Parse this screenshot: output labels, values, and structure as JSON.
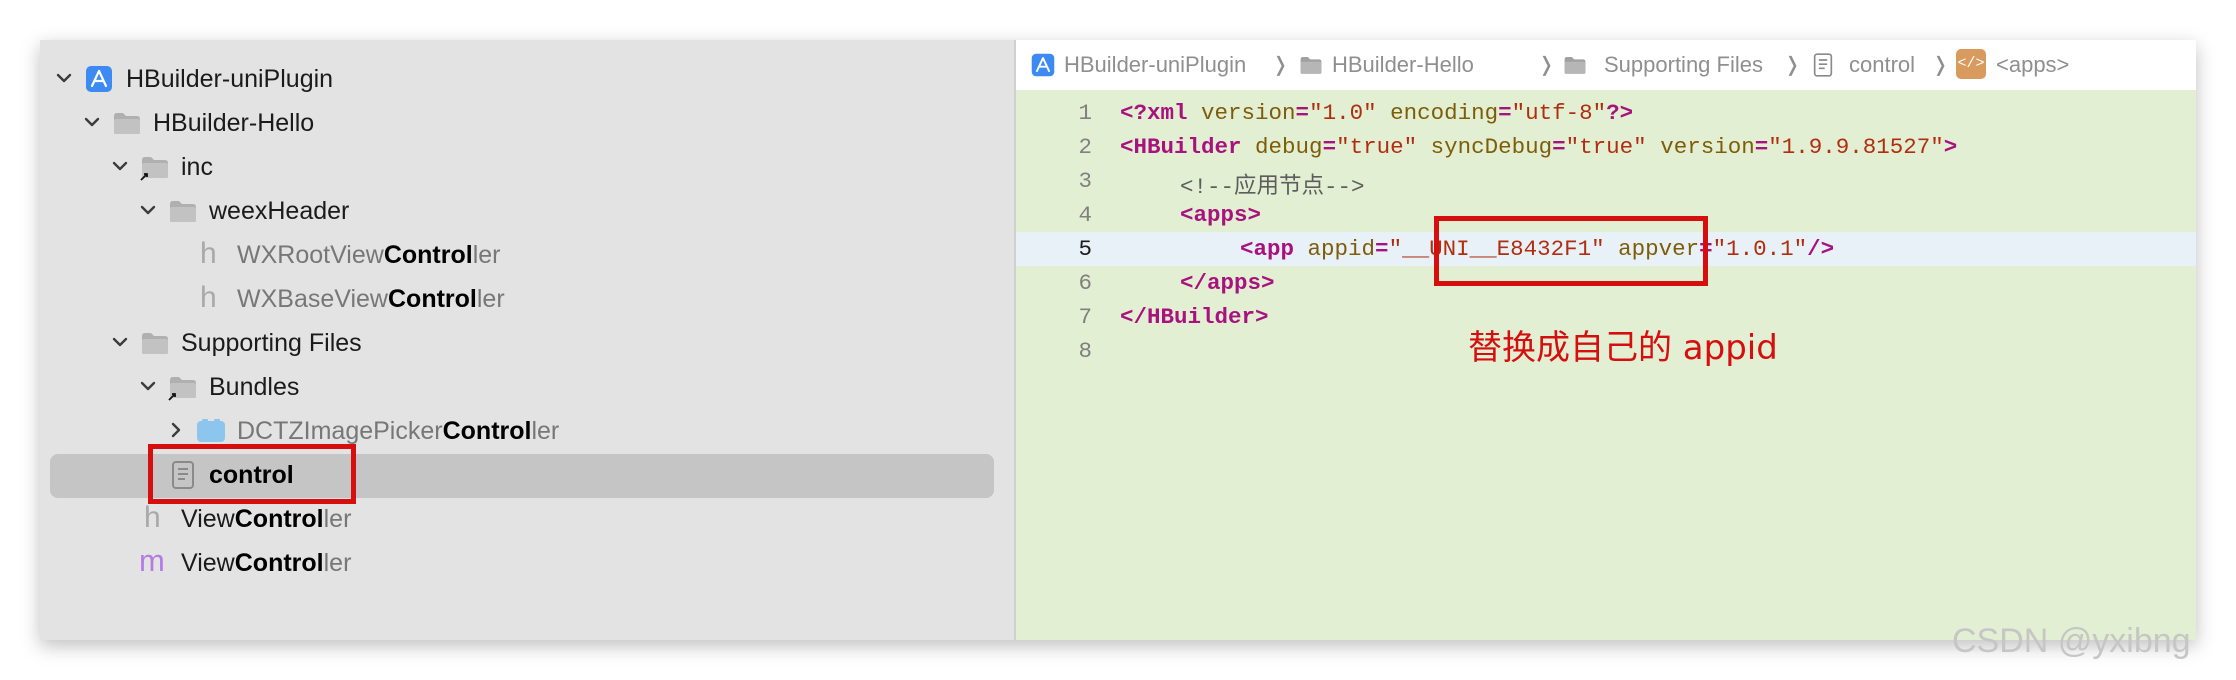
{
  "navigator": {
    "items": [
      {
        "name": "HBuilder-uniPlugin",
        "icon": "xcode-project-icon",
        "expanded": true
      },
      {
        "name": "HBuilder-Hello",
        "icon": "folder-icon",
        "expanded": true
      },
      {
        "name": "inc",
        "icon": "folder-alias-icon",
        "expanded": true
      },
      {
        "name": "weexHeader",
        "icon": "folder-icon",
        "expanded": true
      },
      {
        "name_prefix": "WXRootView",
        "name_match": "Control",
        "name_suffix": "ler",
        "icon": "header-file-icon"
      },
      {
        "name_prefix": "WXBaseView",
        "name_match": "Control",
        "name_suffix": "ler",
        "icon": "header-file-icon"
      },
      {
        "name": "Supporting Files",
        "icon": "folder-icon",
        "expanded": true
      },
      {
        "name": "Bundles",
        "icon": "folder-alias-icon",
        "expanded": true
      },
      {
        "name_prefix": "DCTZImagePicker",
        "name_match": "Control",
        "name_suffix": "ler",
        "icon": "bundle-icon",
        "expanded": false
      },
      {
        "name": "control",
        "icon": "xml-file-icon",
        "selected": true
      },
      {
        "name_prefix": "View",
        "name_match": "Control",
        "name_suffix": "ler",
        "icon": "header-file-icon"
      },
      {
        "name_prefix": "View",
        "name_match": "Control",
        "name_suffix": "ler",
        "icon": "objc-implementation-icon"
      }
    ]
  },
  "jumpbar": {
    "crumbs": [
      "HBuilder-uniPlugin",
      "HBuilder-Hello",
      "Supporting Files",
      "control",
      "<apps>"
    ]
  },
  "editor": {
    "lines": [
      {
        "num": "1"
      },
      {
        "num": "2"
      },
      {
        "num": "3"
      },
      {
        "num": "4"
      },
      {
        "num": "5"
      },
      {
        "num": "6"
      },
      {
        "num": "7"
      },
      {
        "num": "8"
      }
    ],
    "tokens": {
      "xml_decl_open": "<?xml",
      "version_attr": "version",
      "version_val": "\"1.0\"",
      "encoding_attr": "encoding",
      "encoding_val": "\"utf-8\"",
      "xml_decl_close": "?>",
      "hb_open": "<HBuilder",
      "debug_attr": "debug",
      "debug_val": "\"true\"",
      "sync_attr": "syncDebug",
      "sync_val": "\"true\"",
      "hbver_attr": "version",
      "hbver_val": "\"1.9.9.81527\"",
      "tag_close": ">",
      "comment": "<!--应用节点-->",
      "apps_open": "<apps>",
      "app_open": "<app",
      "appid_attr": "appid",
      "appid_val": "\"__UNI__E8432F1\"",
      "appver_attr": "appver",
      "appver_val": "\"1.0.1\"",
      "self_close": "/>",
      "apps_close": "</apps>",
      "hb_close": "</HBuilder>",
      "eq": "="
    }
  },
  "annotation": "替换成自己的 appid",
  "watermark": "CSDN @yxibng",
  "colors": {
    "highlight_box": "#d60e0e",
    "editor_bg": "#e3efd3",
    "current_line": "#e9f1f8",
    "selection": "#c5c5c5",
    "xml_tag": "#a8127e",
    "xml_attr": "#7e5d09",
    "xml_value": "#b12d0f"
  }
}
